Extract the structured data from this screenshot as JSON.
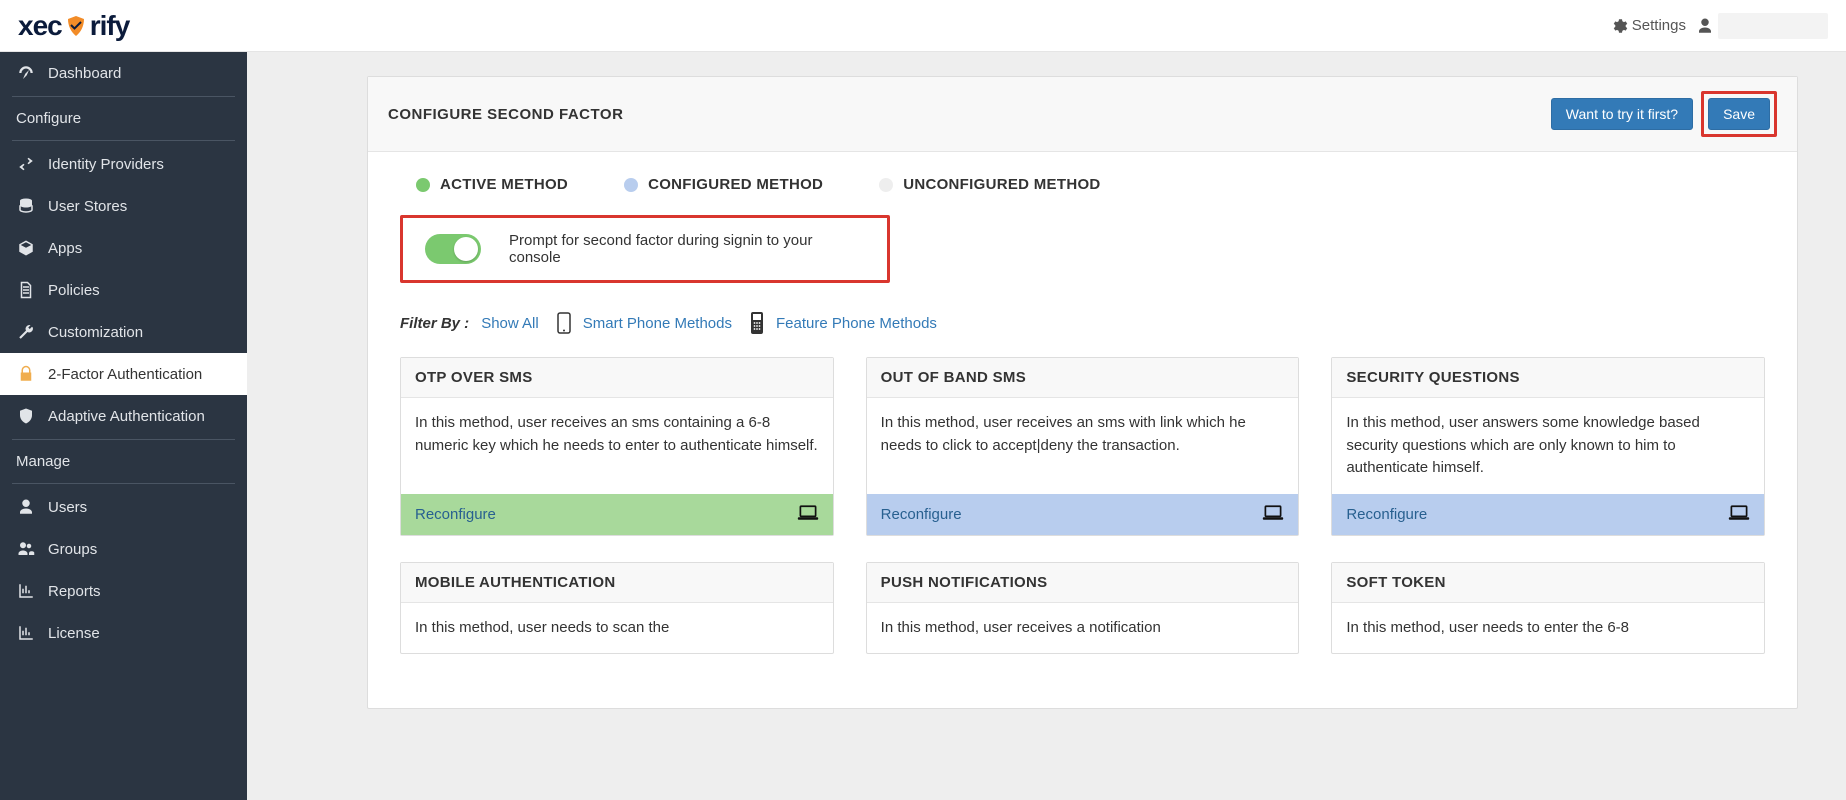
{
  "header": {
    "logo_prefix": "xec",
    "logo_suffix": "rify",
    "settings_label": "Settings"
  },
  "sidebar": {
    "items": [
      {
        "label": "Dashboard",
        "icon": "dashboard"
      },
      {
        "section": true,
        "label": "Configure"
      },
      {
        "label": "Identity Providers",
        "icon": "exchange"
      },
      {
        "label": "User Stores",
        "icon": "database"
      },
      {
        "label": "Apps",
        "icon": "cube"
      },
      {
        "label": "Policies",
        "icon": "file"
      },
      {
        "label": "Customization",
        "icon": "wrench"
      },
      {
        "label": "2-Factor Authentication",
        "icon": "lock",
        "active": true
      },
      {
        "label": "Adaptive Authentication",
        "icon": "shield"
      },
      {
        "section": true,
        "label": "Manage"
      },
      {
        "label": "Users",
        "icon": "user"
      },
      {
        "label": "Groups",
        "icon": "users"
      },
      {
        "label": "Reports",
        "icon": "chart"
      },
      {
        "label": "License",
        "icon": "chart"
      }
    ]
  },
  "panel": {
    "title": "CONFIGURE SECOND FACTOR",
    "try_button": "Want to try it first?",
    "save_button": "Save"
  },
  "legend": {
    "active": "ACTIVE METHOD",
    "configured": "CONFIGURED METHOD",
    "unconfigured": "UNCONFIGURED METHOD"
  },
  "prompt": {
    "text": "Prompt for second factor during signin to your console",
    "enabled": true
  },
  "filter": {
    "label": "Filter By :",
    "show_all": "Show All",
    "smart_phone": "Smart Phone Methods",
    "feature_phone": "Feature Phone Methods"
  },
  "reconfigure_label": "Reconfigure",
  "cards_row1": [
    {
      "title": "OTP OVER SMS",
      "desc": "In this method, user receives an sms containing a 6-8 numeric key which he needs to enter to authenticate himself.",
      "status": "active"
    },
    {
      "title": "OUT OF BAND SMS",
      "desc": "In this method, user receives an sms with link which he needs to click to accept|deny the transaction.",
      "status": "configured"
    },
    {
      "title": "SECURITY QUESTIONS",
      "desc": "In this method, user answers some knowledge based security questions which are only known to him to authenticate himself.",
      "status": "configured"
    }
  ],
  "cards_row2": [
    {
      "title": "MOBILE AUTHENTICATION",
      "desc": "In this method, user needs to scan the"
    },
    {
      "title": "PUSH NOTIFICATIONS",
      "desc": "In this method, user receives a notification"
    },
    {
      "title": "SOFT TOKEN",
      "desc": "In this method, user needs to enter the 6-8"
    }
  ]
}
